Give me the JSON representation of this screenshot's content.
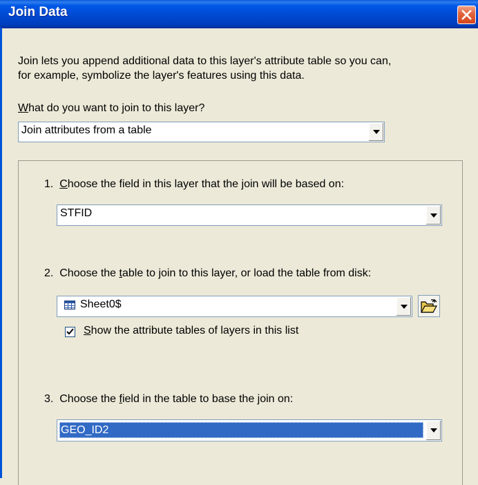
{
  "window": {
    "title": "Join Data"
  },
  "intro": {
    "line1": "Join lets you append additional data to this layer's attribute table so you can,",
    "line2": "for example, symbolize the layer's features using this data."
  },
  "join_type": {
    "label_prefix": "W",
    "label_rest": "hat do you want to join to this layer?",
    "selected": "Join attributes from a table"
  },
  "step1": {
    "label_a": "1.  ",
    "label_u": "C",
    "label_b": "hoose the field in this layer that the join will be based on:",
    "selected": "STFID"
  },
  "step2": {
    "label_a": "2.  Choose the ",
    "label_u": "t",
    "label_b": "able to join to this layer, or load the table from disk:",
    "selected": "Sheet0$",
    "checkbox": {
      "checked": true,
      "label_u": "S",
      "label_rest": "how the attribute tables of layers in this list"
    }
  },
  "step3": {
    "label_a": "3.  Choose the ",
    "label_u": "f",
    "label_b": "ield in the table to base the join on:",
    "selected": "GEO_ID2"
  },
  "icons": {
    "close": "close-icon",
    "table": "table-icon",
    "folder": "open-folder-icon",
    "dropdown": "chevron-down-icon"
  },
  "colors": {
    "titlebar": "#0047cf",
    "close": "#d5471c",
    "selection": "#316ac5",
    "dialog_bg": "#ece9d8"
  }
}
